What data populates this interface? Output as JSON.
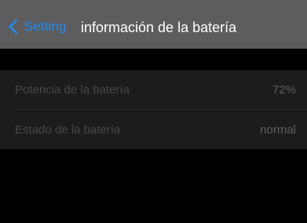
{
  "nav": {
    "back_label": "Setting",
    "title": "información de la batería",
    "back_icon": "chevron-left-icon"
  },
  "battery": {
    "rows": [
      {
        "label": "Potencia de la batería",
        "value": "72%"
      },
      {
        "label": "Estado de la batería",
        "value": "normal"
      }
    ]
  },
  "colors": {
    "nav_background": "#5d5d5f",
    "accent": "#1f8cf0",
    "group_background": "#1c1c1e",
    "page_background": "#000000"
  }
}
